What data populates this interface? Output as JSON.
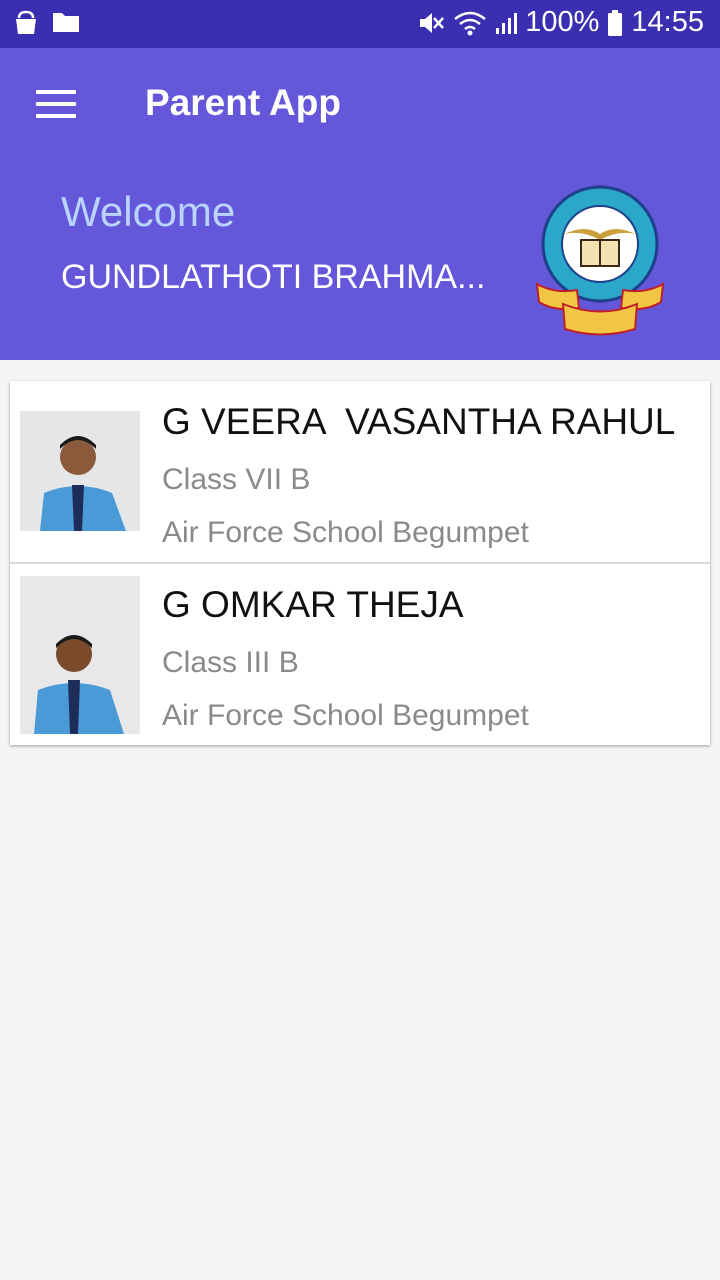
{
  "status_bar": {
    "battery": "100%",
    "time": "14:55",
    "icons": [
      "bag-icon",
      "folder-icon",
      "mute-icon",
      "wifi-icon",
      "signal-icon",
      "battery-icon"
    ]
  },
  "app_bar": {
    "title": "Parent App",
    "welcome": "Welcome",
    "user_name": "GUNDLATHOTI BRAHMA...",
    "colors": {
      "header": "#6557d9",
      "status": "#3a2fb0",
      "welcome": "#b9d4ff"
    }
  },
  "students": [
    {
      "name": "G VEERA  VASANTHA RAHUL",
      "class": "Class VII B",
      "school": "Air Force School Begumpet"
    },
    {
      "name": "G OMKAR THEJA",
      "class": "Class III B",
      "school": "Air Force School Begumpet"
    }
  ]
}
